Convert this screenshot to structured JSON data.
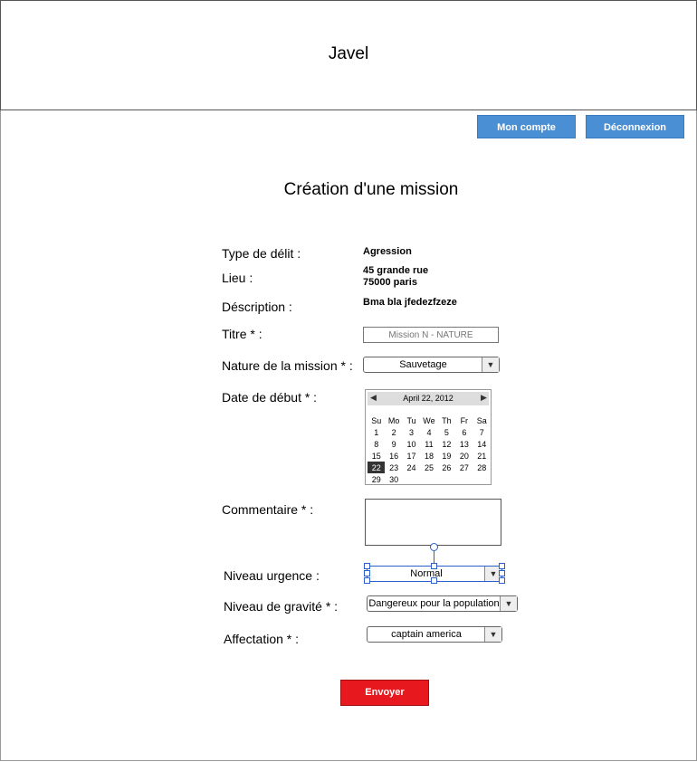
{
  "app": {
    "title": "Javel"
  },
  "topnav": {
    "account_label": "Mon compte",
    "logout_label": "Déconnexion"
  },
  "page": {
    "title": "Création d'une mission"
  },
  "form": {
    "type_label": "Type de délit  :",
    "type_value": "Agression",
    "lieu_label": "Lieu  :",
    "lieu_line1": "45 grande rue",
    "lieu_line2": "75000 paris",
    "desc_label": "Déscription :",
    "desc_value": "Bma bla jfedezfzeze",
    "titre_label": "Titre * :",
    "titre_placeholder": "Mission N - NATURE",
    "nature_label": "Nature de la mission * :",
    "nature_value": "Sauvetage",
    "date_label": "Date de début * :",
    "comment_label": "Commentaire * :",
    "urgence_label": "Niveau urgence  :",
    "urgence_value": "Normal",
    "gravite_label": "Niveau de gravité * :",
    "gravite_value": "Dangereux pour la population",
    "affect_label": "Affectation * :",
    "affect_value": "captain america",
    "submit_label": "Envoyer"
  },
  "calendar": {
    "month_label": "April 22, 2012",
    "weekdays": [
      "Su",
      "Mo",
      "Tu",
      "We",
      "Th",
      "Fr",
      "Sa"
    ],
    "weeks": [
      [
        "1",
        "2",
        "3",
        "4",
        "5",
        "6",
        "7"
      ],
      [
        "8",
        "9",
        "10",
        "11",
        "12",
        "13",
        "14"
      ],
      [
        "15",
        "16",
        "17",
        "18",
        "19",
        "20",
        "21"
      ],
      [
        "22",
        "23",
        "24",
        "25",
        "26",
        "27",
        "28"
      ],
      [
        "29",
        "30",
        "",
        "",
        "",
        "",
        ""
      ]
    ],
    "selected": "22"
  },
  "icons": {
    "dropdown": "chevron-down-icon",
    "prev": "triangle-left-icon",
    "next": "triangle-right-icon"
  },
  "colors": {
    "accent": "#4a8fd4",
    "submit": "#e8191e",
    "selection": "#2a5fd0"
  }
}
